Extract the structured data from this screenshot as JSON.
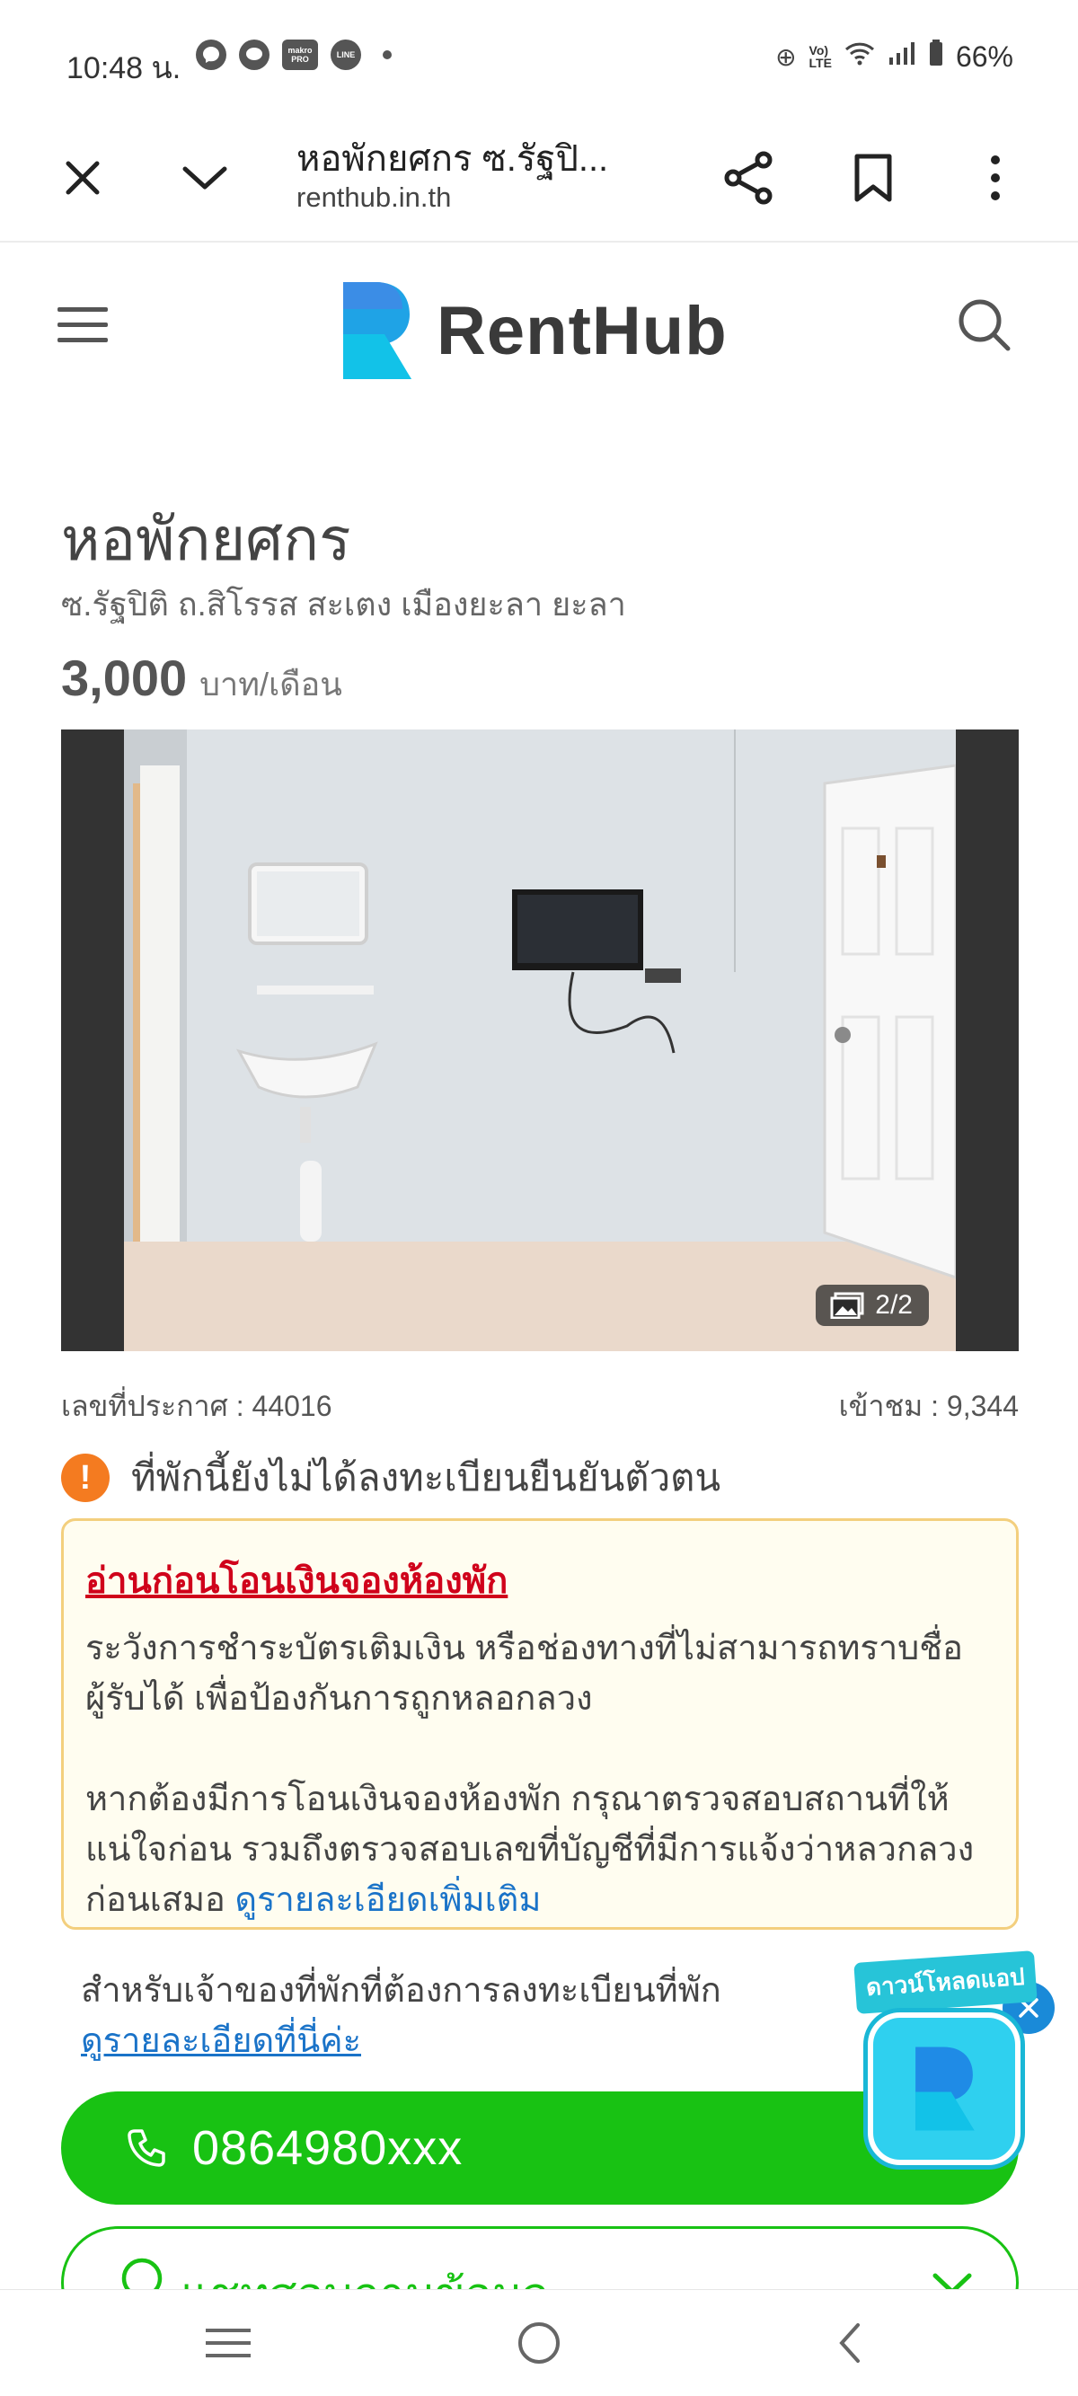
{
  "status_bar": {
    "time": "10:48 น.",
    "battery": "66%",
    "app_icons": [
      "messenger-icon",
      "chat-icon",
      "makro-pro-icon",
      "line-icon"
    ],
    "makro_label": "makro PRO",
    "line_label": "LINE"
  },
  "browser": {
    "page_title": "หอพักยศกร ซ.รัฐปิ...",
    "url": "renthub.in.th"
  },
  "site": {
    "brand_name": "RentHub",
    "brand_color": "#1fa3e6"
  },
  "listing": {
    "title": "หอพักยศกร",
    "address": "ซ.รัฐปิติ ถ.สิโรรส สะเตง เมืองยะลา ยะลา",
    "price": "3,000",
    "price_unit": "บาท/เดือน",
    "photo_counter": "2/2",
    "announcement_no": "เลขที่ประกาศ : 44016",
    "views": "เข้าชม : 9,344",
    "verification_warning": "ที่พักนี้ยังไม่ได้ลงทะเบียนยืนยันตัวตน"
  },
  "notice": {
    "title": "อ่านก่อนโอนเงินจองห้องพัก",
    "paragraph1": "ระวังการชำระบัตรเติมเงิน หรือช่องทางที่ไม่สามารถทราบชื่อผู้รับได้ เพื่อป้องกันการถูกหลอกลวง",
    "paragraph2": "หากต้องมีการโอนเงินจองห้องพัก กรุณาตรวจสอบสถานที่ให้แน่ใจก่อน รวมถึงตรวจสอบเลขที่บัญชีที่มีการแจ้งว่าหลวกลวงก่อนเสมอ ",
    "more_link": "ดูรายละเอียดเพิ่มเติม"
  },
  "owner": {
    "text": "สำหรับเจ้าของที่พักที่ต้องการลงทะเบียนที่พัก",
    "link": "ดูรายละเอียดที่นี่ค่ะ"
  },
  "actions": {
    "phone": "0864980xxx",
    "chat": "แชทสอบถามข้อมูล",
    "download_app": "ดาวน์โหลดแอป"
  },
  "colors": {
    "accent_green": "#18c213",
    "link_blue": "#1a73c8",
    "warning_orange": "#f47b20",
    "alert_red": "#d0021b"
  }
}
